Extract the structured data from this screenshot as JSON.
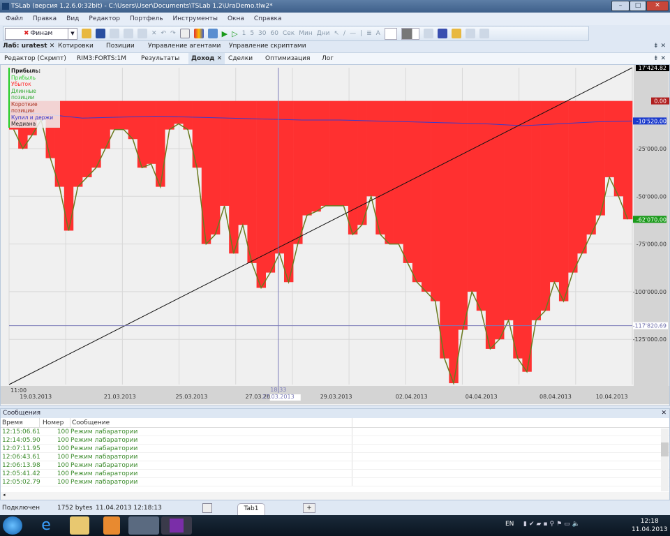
{
  "window": {
    "title": "TSLab (версия 1.2.6.0:32bit) - C:\\Users\\User\\Documents\\TSLab 1.2\\UraDemo.tlw2*",
    "min": "–",
    "max": "□",
    "close": "✕"
  },
  "menu": [
    "Файл",
    "Правка",
    "Вид",
    "Редактор",
    "Портфель",
    "Инструменты",
    "Окна",
    "Справка"
  ],
  "toolbar": {
    "provider": "Финам",
    "intervals": [
      "1",
      "5",
      "30",
      "60"
    ],
    "units": [
      "Сек",
      "Мин",
      "Дни"
    ]
  },
  "tabs1": [
    "Лаб: uratest",
    "Котировки",
    "Позиции",
    "Управление агентами",
    "Управление скриптами"
  ],
  "tabs2": [
    "Редактор (Скрипт)",
    "RIM3:FORTS:1M",
    "Результаты",
    "Доход",
    "Сделки",
    "Оптимизация",
    "Лог"
  ],
  "pin": "⇟ ✕",
  "chart_data": {
    "type": "area",
    "legend": {
      "title": "Прибыль:",
      "items": [
        "Прибыль",
        "Убыток",
        "Длинные позиции",
        "Короткие позиции",
        "Купил и держи",
        "Медиана"
      ],
      "colors": [
        "#33cc33",
        "#ff2a2a",
        "#33aa33",
        "#aa3322",
        "#3333cc",
        "#222222"
      ]
    },
    "equity": [
      -15000,
      -25000,
      -18000,
      -10000,
      -30000,
      -45000,
      -68000,
      -45000,
      -40000,
      -35000,
      -25000,
      -15000,
      -15000,
      -20000,
      -35000,
      -33000,
      -45000,
      -15000,
      -12000,
      -15000,
      -35000,
      -75000,
      -70000,
      -55000,
      -80000,
      -65000,
      -85000,
      -98000,
      -90000,
      -80000,
      -95000,
      -75000,
      -60000,
      -58000,
      -55000,
      -55000,
      -55000,
      -70000,
      -65000,
      -50000,
      -70000,
      -75000,
      -75000,
      -85000,
      -95000,
      -100000,
      -105000,
      -135000,
      -148000,
      -120000,
      -100000,
      -110000,
      -130000,
      -125000,
      -115000,
      -135000,
      -142000,
      -115000,
      -110000,
      -95000,
      -105000,
      -90000,
      -80000,
      -70000,
      -60000,
      -40000,
      -50000,
      -62070
    ],
    "median": [
      -5500,
      -7000,
      -9000,
      -8500,
      -8000,
      -8500,
      -9000,
      -9500,
      -10000,
      -10000,
      -10500,
      -11000,
      -11500,
      -12000,
      -13000,
      -12000,
      -11000,
      -10520
    ],
    "buy_hold": {
      "start": -148700,
      "end": 17424.82
    },
    "ylim": [
      -148700,
      17424.82
    ],
    "yticks": [
      "-25'000.00",
      "-50'000.00",
      "-75'000.00",
      "-100'000.00",
      "-125'000.00"
    ],
    "ytick_values": [
      -25000,
      -50000,
      -75000,
      -100000,
      -125000
    ],
    "markers": [
      {
        "label": "17'424.82",
        "value": 17424.82,
        "color": "#000000"
      },
      {
        "label": "0.00",
        "value": 0,
        "color": "#b02020"
      },
      {
        "label": "-10'520.00",
        "value": -10520,
        "color": "#1a3acc"
      },
      {
        "label": "-62'070.00",
        "value": -62070,
        "color": "#1a9a1a"
      }
    ],
    "crosshair": {
      "value": -117820.69,
      "label": "-117'820.69",
      "time": "18:33",
      "date": "27.03.2013",
      "pos": 0.432
    },
    "xlabels": [
      "19.03.2013",
      "21.03.2013",
      "25.03.2013",
      "27.03.2013",
      "29.03.2013",
      "02.04.2013",
      "04.04.2013",
      "08.04.2013",
      "10.04.2013"
    ],
    "xlabel_pos": [
      0.045,
      0.18,
      0.295,
      0.407,
      0.527,
      0.648,
      0.76,
      0.879,
      0.995
    ],
    "start_time": "11:00"
  },
  "messages": {
    "title": "Сообщения",
    "cols": [
      "Время",
      "Номер",
      "Сообщение"
    ],
    "rows": [
      [
        "12:15:06.61",
        "100",
        "Режим лабаратории"
      ],
      [
        "12:14:05.90",
        "100",
        "Режим лабаратории"
      ],
      [
        "12:07:11.95",
        "100",
        "Режим лабаратории"
      ],
      [
        "12:06:43.61",
        "100",
        "Режим лабаратории"
      ],
      [
        "12:06:13.98",
        "100",
        "Режим лабаратории"
      ],
      [
        "12:05:41.42",
        "100",
        "Режим лабаратории"
      ],
      [
        "12:05:02.79",
        "100",
        "Режим лабаратории"
      ]
    ]
  },
  "status": {
    "conn": "Подключен",
    "bytes": "1752 bytes",
    "datetime": "11.04.2013 12:18:13",
    "tab": "Tab1",
    "add": "+"
  },
  "tray": {
    "lang": "EN",
    "time": "12:18",
    "date": "11.04.2013"
  }
}
